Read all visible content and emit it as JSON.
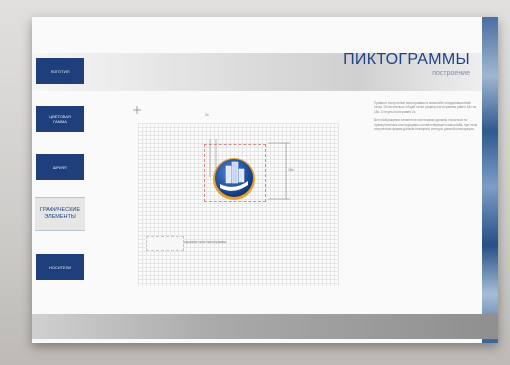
{
  "header": {
    "title": "ПИКТОГРАММЫ",
    "subtitle": "построение"
  },
  "nav": {
    "items": [
      {
        "label": "ЛОГОТИП",
        "sublabel": ""
      },
      {
        "label": "ЦВЕТОВАЯ",
        "sublabel": "ГАММА"
      },
      {
        "label": "ШРИФТ",
        "sublabel": ""
      },
      {
        "label": "ГРАФИЧЕСКИЕ",
        "sublabel": "ЭЛЕМЕНТЫ"
      },
      {
        "label": "НОСИТЕЛИ",
        "sublabel": ""
      }
    ]
  },
  "content": {
    "paragraphs": [
      "Правило построения пиктограммы в масштабе координационной сетки. Относительно общей сетки размер пиктограммы равен 18х на 18х. Отступы поля равен 2х.",
      "Все изображения элементов пиктограмм должны строиться по прямоугольным конструкциям соответствующего масштаба, при этом полученная форма должна повторять контуры данной конструкции."
    ],
    "caption": "охранное поле пиктограммы",
    "dim_right": "18х",
    "dim_top": "2х"
  },
  "colors": {
    "brand_blue": "#1e3f7b",
    "accent_orange": "#e8a22b",
    "frame_red": "#d98c8c"
  }
}
